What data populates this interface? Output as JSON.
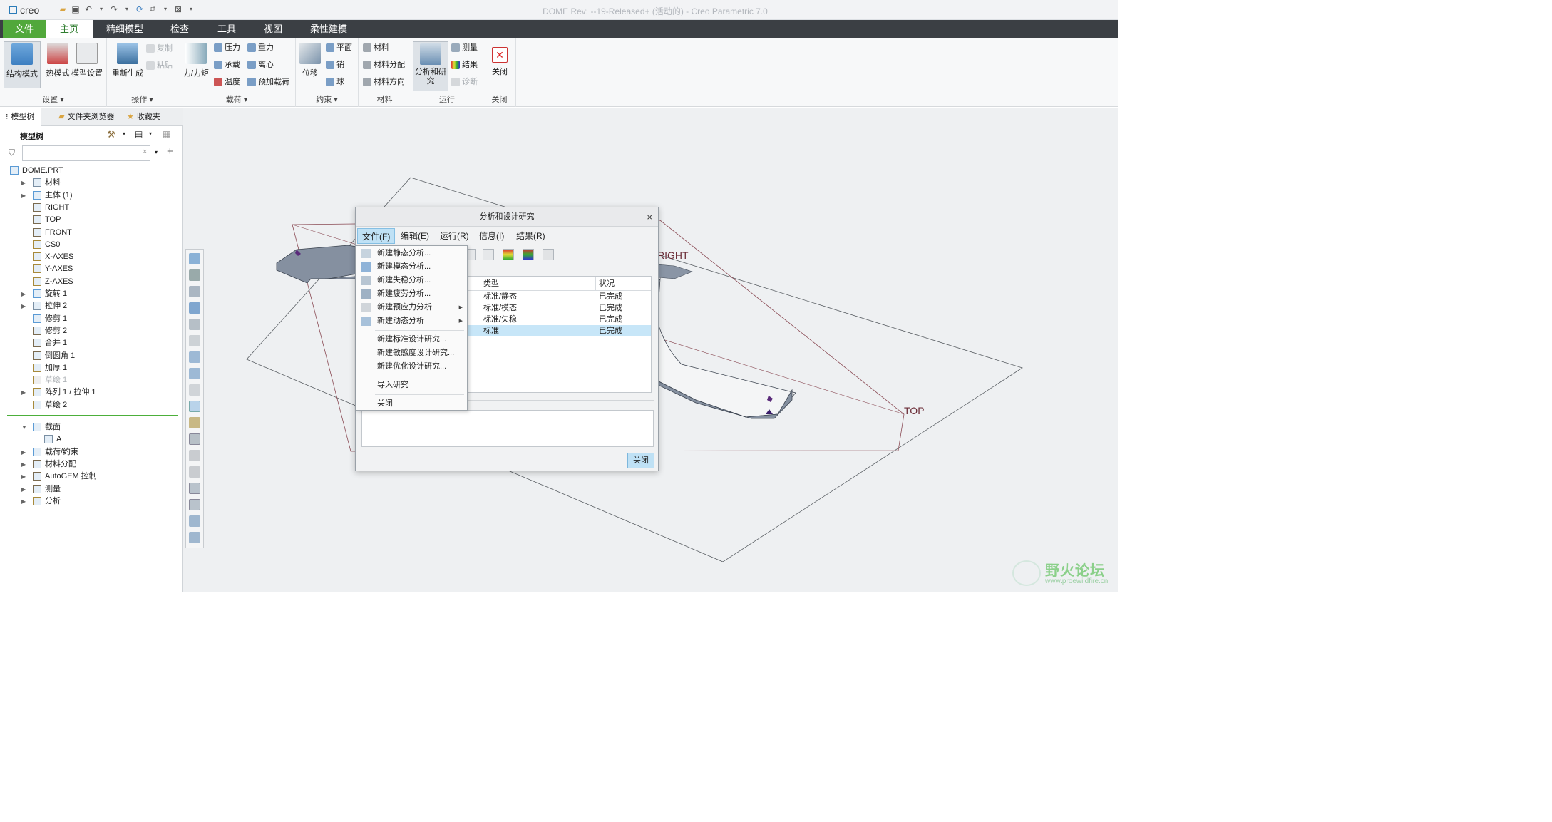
{
  "titlebar": {
    "logo": "creo",
    "window_title": "DOME Rev: --19-Released+ (活动的) - Creo Parametric 7.0"
  },
  "ribbon_tabs": [
    "文件",
    "主页",
    "精细模型",
    "检查",
    "工具",
    "视图",
    "柔性建模"
  ],
  "ribbon": {
    "setup": {
      "label": "设置",
      "buttons": [
        "结构模式",
        "热模式",
        "模型设置"
      ]
    },
    "operations": {
      "label": "操作",
      "regenerate": "重新生成",
      "copy": "复制",
      "paste": "粘贴"
    },
    "loads": {
      "label": "载荷",
      "force": "力/力矩",
      "pressure": "压力",
      "gravity": "重力",
      "bearing": "承载",
      "centrifugal": "离心",
      "temperature": "温度",
      "preload": "预加载荷"
    },
    "constraints": {
      "label": "约束",
      "displacement": "位移",
      "plane": "平面",
      "pin": "销",
      "ball": "球"
    },
    "materials": {
      "label": "材料",
      "material": "材料",
      "assignment": "材料分配",
      "orientation": "材料方向"
    },
    "run": {
      "label": "运行",
      "analyses": "分析和研究",
      "measures": "测量",
      "results": "结果",
      "diagnostics": "诊断"
    },
    "close": {
      "label": "关闭",
      "button": "关闭"
    }
  },
  "left_panel": {
    "tabs": [
      "模型树",
      "文件夹浏览器",
      "收藏夹"
    ],
    "header": "模型树",
    "filter_placeholder": "",
    "tree": [
      {
        "label": "DOME.PRT",
        "expand": false,
        "indent": 0
      },
      {
        "label": "材料",
        "expand": true,
        "indent": 1
      },
      {
        "label": "主体 (1)",
        "expand": true,
        "indent": 1
      },
      {
        "label": "RIGHT",
        "expand": false,
        "indent": 1
      },
      {
        "label": "TOP",
        "expand": false,
        "indent": 1
      },
      {
        "label": "FRONT",
        "expand": false,
        "indent": 1
      },
      {
        "label": "CS0",
        "expand": false,
        "indent": 1
      },
      {
        "label": "X-AXES",
        "expand": false,
        "indent": 1
      },
      {
        "label": "Y-AXES",
        "expand": false,
        "indent": 1
      },
      {
        "label": "Z-AXES",
        "expand": false,
        "indent": 1
      },
      {
        "label": "旋转 1",
        "expand": true,
        "indent": 1
      },
      {
        "label": "拉伸 2",
        "expand": true,
        "indent": 1
      },
      {
        "label": "修剪 1",
        "expand": false,
        "indent": 1
      },
      {
        "label": "修剪 2",
        "expand": false,
        "indent": 1
      },
      {
        "label": "合并 1",
        "expand": false,
        "indent": 1
      },
      {
        "label": "倒圆角 1",
        "expand": false,
        "indent": 1
      },
      {
        "label": "加厚 1",
        "expand": false,
        "indent": 1
      },
      {
        "label": "草绘 1",
        "expand": false,
        "indent": 1,
        "disabled": true
      },
      {
        "label": "阵列 1 / 拉伸 1",
        "expand": true,
        "indent": 1
      },
      {
        "label": "草绘 2",
        "expand": false,
        "indent": 1
      }
    ],
    "tree2": [
      {
        "label": "截面",
        "expand": "open",
        "indent": 1
      },
      {
        "label": "A",
        "expand": false,
        "indent": 2
      },
      {
        "label": "载荷/约束",
        "expand": true,
        "indent": 1
      },
      {
        "label": "材料分配",
        "expand": true,
        "indent": 1
      },
      {
        "label": "AutoGEM 控制",
        "expand": true,
        "indent": 1
      },
      {
        "label": "测量",
        "expand": true,
        "indent": 1
      },
      {
        "label": "分析",
        "expand": true,
        "indent": 1
      }
    ]
  },
  "canvas": {
    "labels": {
      "right": "RIGHT",
      "top": "TOP"
    }
  },
  "dialog": {
    "title": "分析和设计研究",
    "menu": [
      "文件(F)",
      "编辑(E)",
      "运行(R)",
      "信息(I)",
      "结果(R)"
    ],
    "table": {
      "columns": [
        "类型",
        "状况"
      ],
      "rows": [
        {
          "type": "标准/静态",
          "status": "已完成"
        },
        {
          "type": "标准/模态",
          "status": "已完成"
        },
        {
          "type": "标准/失稳",
          "status": "已完成"
        },
        {
          "type": "标准",
          "status": "已完成",
          "selected": true
        }
      ]
    },
    "close_button": "关闭"
  },
  "file_menu": {
    "items": [
      {
        "label": "新建静态分析...",
        "submenu": false
      },
      {
        "label": "新建模态分析...",
        "submenu": false
      },
      {
        "label": "新建失稳分析...",
        "submenu": false
      },
      {
        "label": "新建疲劳分析...",
        "submenu": false
      },
      {
        "label": "新建预应力分析",
        "submenu": true
      },
      {
        "label": "新建动态分析",
        "submenu": true
      }
    ],
    "items2": [
      "新建标准设计研究...",
      "新建敏感度设计研究...",
      "新建优化设计研究..."
    ],
    "items3": [
      "导入研究"
    ],
    "items4": [
      "关闭"
    ]
  },
  "watermark": {
    "title": "野火论坛",
    "url": "www.proewildfire.cn"
  }
}
